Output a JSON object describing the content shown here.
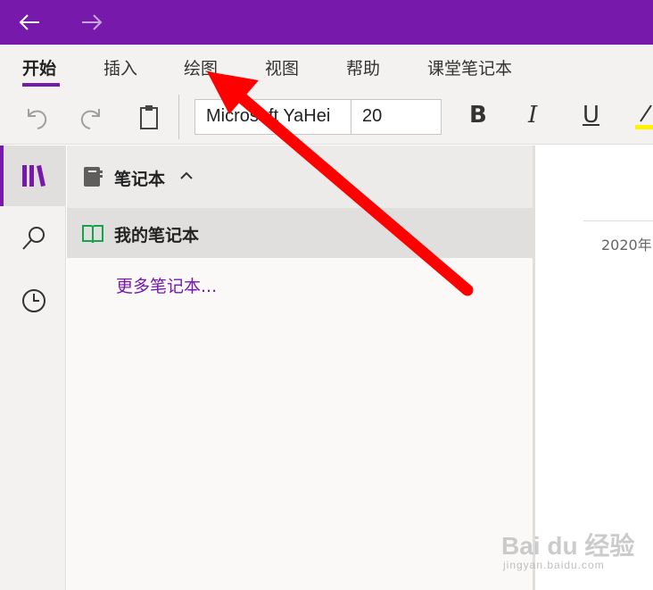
{
  "colors": {
    "accent": "#7719aa",
    "annotation": "#ff0000",
    "link": "#7719aa"
  },
  "titlebar": {
    "back_icon": "arrow-left-icon",
    "forward_icon": "arrow-right-icon"
  },
  "tabs": [
    {
      "label": "开始",
      "active": true
    },
    {
      "label": "插入"
    },
    {
      "label": "绘图"
    },
    {
      "label": "视图"
    },
    {
      "label": "帮助"
    },
    {
      "label": "课堂笔记本"
    }
  ],
  "toolbar": {
    "font_name": "Microsoft YaHei",
    "font_size": "20",
    "bold_label": "B",
    "italic_label": "I",
    "underline_label": "U"
  },
  "notebook_pane": {
    "header_title": "笔记本",
    "notebook_name": "我的笔记本",
    "more_link": "更多笔记本..."
  },
  "page": {
    "date": "2020年"
  },
  "watermark": {
    "text": "Bai du 经验",
    "sub": "jingyan.baidu.com"
  }
}
